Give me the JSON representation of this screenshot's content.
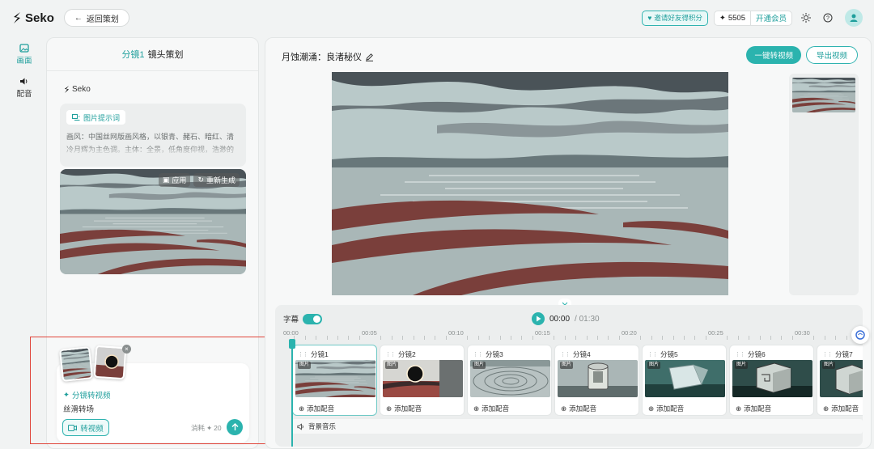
{
  "header": {
    "logo_text": "Seko",
    "back_label": "返回策划",
    "invite_label": "邀请好友得积分",
    "points": "5505",
    "vip_label": "开通会员"
  },
  "rail": {
    "items": [
      {
        "label": "画面",
        "icon": "image-icon",
        "active": true
      },
      {
        "label": "配音",
        "icon": "speaker-icon",
        "active": false
      }
    ]
  },
  "left_panel": {
    "shot_label": "分镜1",
    "title": "镜头策划",
    "brand": "Seko",
    "prompt_tag": "图片提示词",
    "prompt_text": "画风：中国丝网版画风格，以银青、赭石、暗红、清冷月辉为主色调。主体：全景，低角度仰视，浩渺的",
    "apply_label": "应用",
    "regen_label": "重新生成",
    "video_card": {
      "title": "分镜转视频",
      "desc": "丝滑转场",
      "button": "转视频",
      "cost_label": "消耗",
      "cost_value": "20"
    }
  },
  "main": {
    "title": "月蚀潮涌：良渚秘仪",
    "primary_btn": "一键转视频",
    "outline_btn": "导出视频",
    "timeline": {
      "subtitle_label": "字幕",
      "current_time": "00:00",
      "total_time": "/ 01:30",
      "ticks": [
        "00:00",
        "00:05",
        "00:10",
        "00:15",
        "00:20",
        "00:25",
        "00:30"
      ],
      "shots": [
        {
          "label": "分镜1",
          "badge": "图片",
          "dub": "添加配音",
          "scene": "sea"
        },
        {
          "label": "分镜2",
          "badge": "图片",
          "dub": "添加配音",
          "scene": "eclipse"
        },
        {
          "label": "分镜3",
          "badge": "图片",
          "dub": "添加配音",
          "scene": "ripples"
        },
        {
          "label": "分镜4",
          "badge": "图片",
          "dub": "添加配音",
          "scene": "jade"
        },
        {
          "label": "分镜5",
          "badge": "图片",
          "dub": "添加配音",
          "scene": "ice"
        },
        {
          "label": "分镜6",
          "badge": "图片",
          "dub": "添加配音",
          "scene": "cube"
        },
        {
          "label": "分镜7",
          "badge": "图片",
          "dub": "添加配音",
          "scene": "cube2"
        }
      ],
      "bgm_label": "背景音乐"
    }
  },
  "colors": {
    "accent": "#2bb3ae",
    "highlight_border": "#e0453a"
  }
}
